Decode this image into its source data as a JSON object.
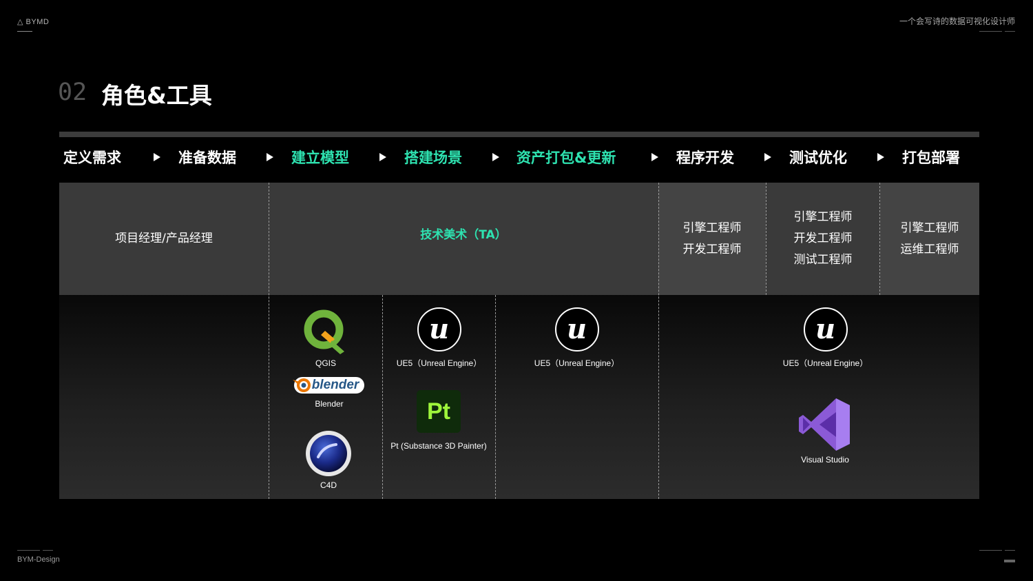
{
  "header": {
    "logo_text": "BYMD",
    "tagline": "一个会写诗的数据可视化设计师"
  },
  "title": {
    "number": "02",
    "text": "角色&工具"
  },
  "steps": [
    {
      "label": "定义需求",
      "highlight": false
    },
    {
      "label": "准备数据",
      "highlight": false
    },
    {
      "label": "建立模型",
      "highlight": true
    },
    {
      "label": "搭建场景",
      "highlight": true
    },
    {
      "label": "资产打包&更新",
      "highlight": true
    },
    {
      "label": "程序开发",
      "highlight": false
    },
    {
      "label": "测试优化",
      "highlight": false
    },
    {
      "label": "打包部署",
      "highlight": false
    }
  ],
  "roles": {
    "pm": "项目经理/产品经理",
    "ta": "技术美术（TA）",
    "dev": [
      "引擎工程师",
      "开发工程师"
    ],
    "test": [
      "引擎工程师",
      "开发工程师",
      "测试工程师"
    ],
    "deploy": [
      "引擎工程师",
      "运维工程师"
    ]
  },
  "tools": {
    "qgis": "QGIS",
    "blender": "Blender",
    "blender_logo_text": "blender",
    "c4d": "C4D",
    "ue_scene": "UE5（Unreal Engine）",
    "pt": "Pt (Substance 3D Painter)",
    "pt_logo_text": "Pt",
    "ue_package": "UE5（Unreal Engine）",
    "ue_dev": "UE5（Unreal Engine）",
    "vs": "Visual Studio",
    "ue_logo_text": "u"
  },
  "footer": {
    "brand": "BYM-Design"
  },
  "colors": {
    "accent": "#2ee2b0",
    "background": "#000000",
    "panel": "#3a3a3a"
  }
}
